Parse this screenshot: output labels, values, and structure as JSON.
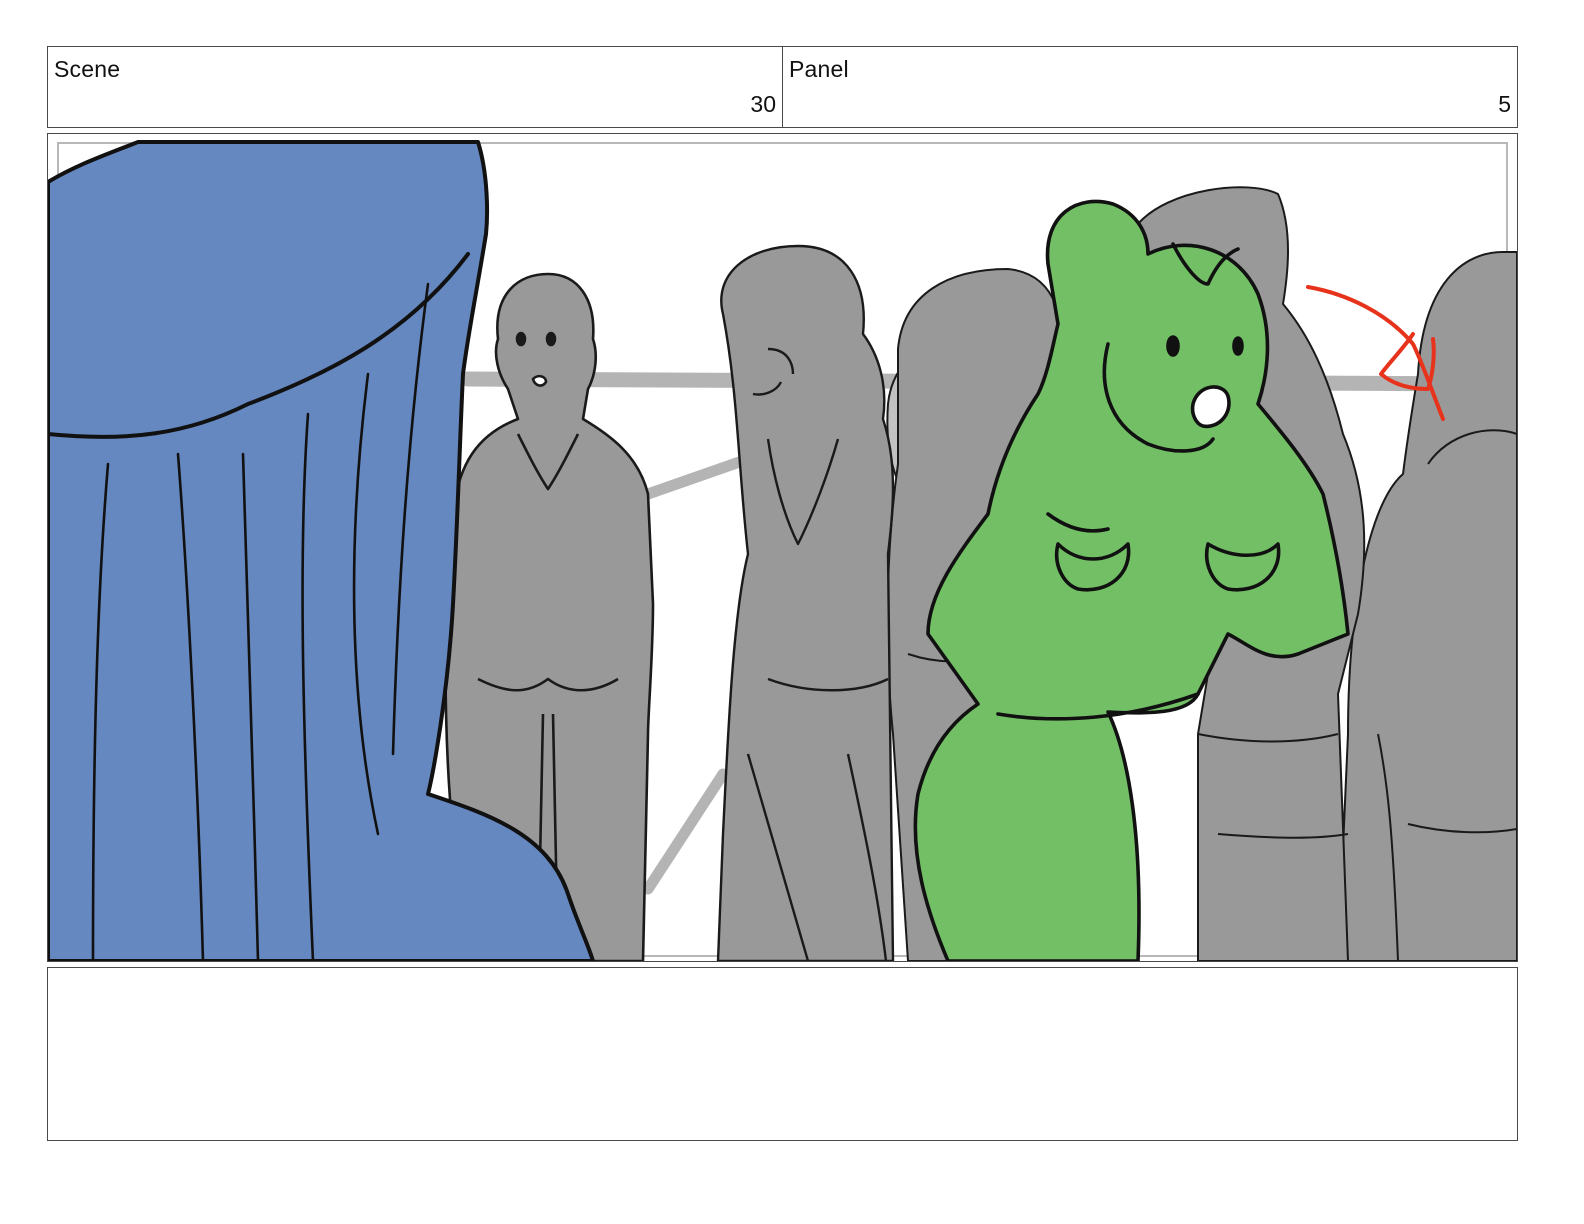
{
  "header": {
    "scene_label": "Scene",
    "scene_number": "30",
    "panel_label": "Panel",
    "panel_number": "5"
  },
  "notes": {
    "text": ""
  },
  "colors": {
    "background": "#ffffff",
    "border": "#4a4a4a",
    "foreground_figure_blue": "#6688c0",
    "crowd_gray": "#999999",
    "crowd_light_gray": "#c2c2c2",
    "highlighted_figure_green": "#73bf66",
    "ink": "#111111",
    "annotation_red": "#e8331c"
  }
}
